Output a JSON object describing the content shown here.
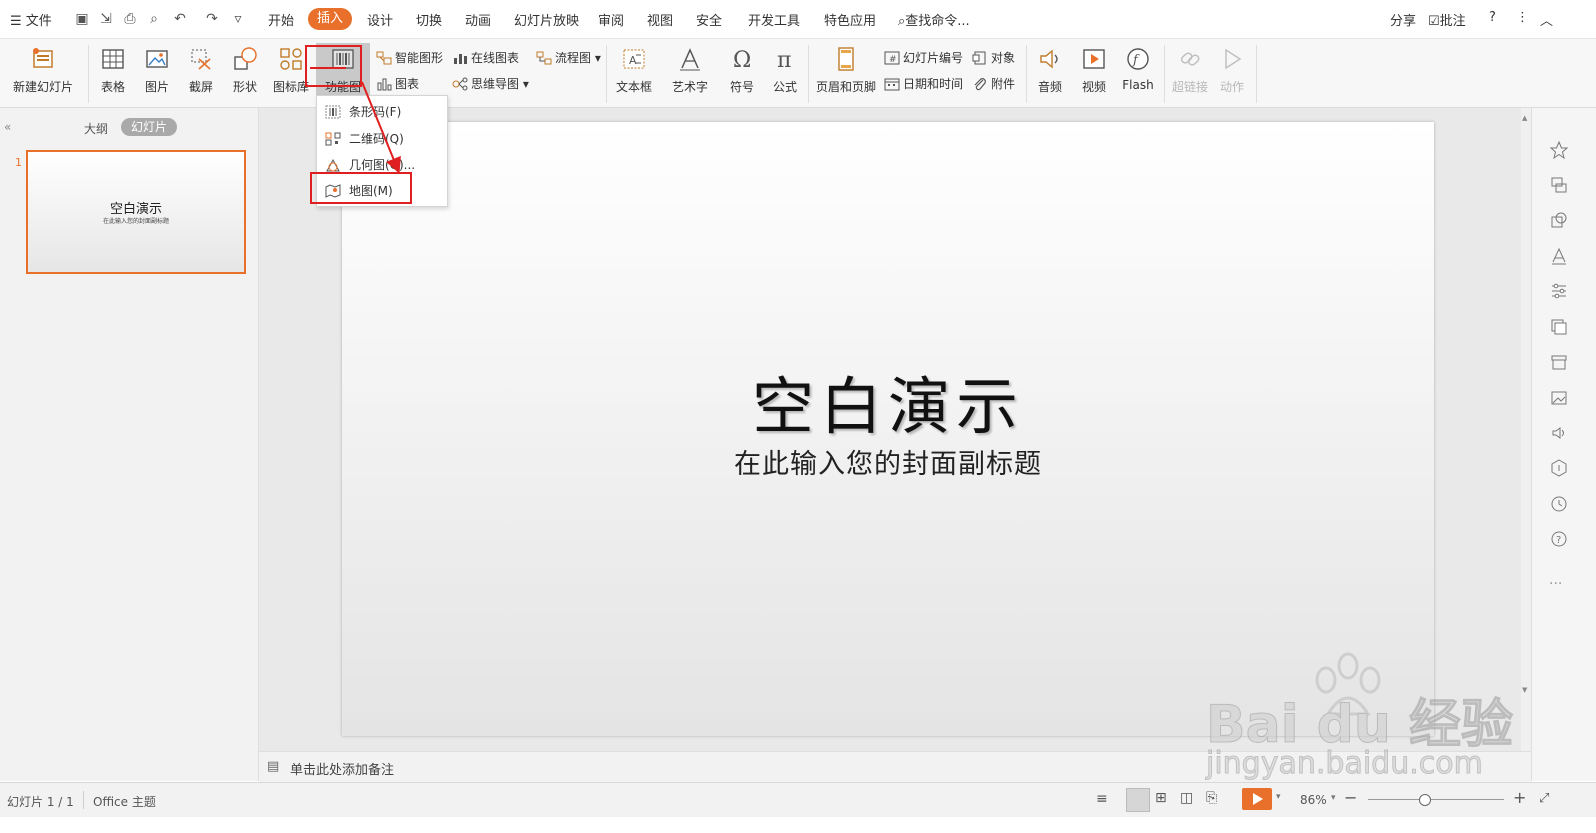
{
  "menubar": {
    "file_label": "文件",
    "tabs": [
      "开始",
      "插入",
      "设计",
      "切换",
      "动画",
      "幻灯片放映",
      "审阅",
      "视图",
      "安全",
      "开发工具",
      "特色应用"
    ],
    "active_tab": "插入",
    "search_label": "查找命令...",
    "share_label": "分享",
    "comment_label": "批注",
    "help_label": "?"
  },
  "ribbon": {
    "new_slide": "新建幻灯片",
    "table": "表格",
    "picture": "图片",
    "screenshot": "截屏",
    "shape": "形状",
    "icon_lib": "图标库",
    "function_chart": "功能图",
    "smart_art": "智能图形",
    "online_chart": "在线图表",
    "flowchart": "流程图",
    "chart": "图表",
    "mindmap": "思维导图",
    "textbox": "文本框",
    "wordart": "艺术字",
    "symbol": "符号",
    "formula": "公式",
    "header_footer": "页眉和页脚",
    "slide_number": "幻灯片编号",
    "object": "对象",
    "date_time": "日期和时间",
    "attachment": "附件",
    "audio": "音频",
    "video": "视频",
    "flash": "Flash",
    "hyperlink": "超链接",
    "action": "动作"
  },
  "dropdown": {
    "items": [
      "条形码(F)",
      "二维码(Q)",
      "几何图(G)...",
      "地图(M)"
    ]
  },
  "left_panel": {
    "view_outline": "大纲",
    "view_slides": "幻灯片",
    "slide_number": "1",
    "thumb_title": "空白演示",
    "thumb_subtitle": "在此输入您的封面副标题"
  },
  "slide": {
    "title": "空白演示",
    "subtitle": "在此输入您的封面副标题"
  },
  "notes": {
    "placeholder": "单击此处添加备注"
  },
  "status": {
    "slide_counter": "幻灯片 1 / 1",
    "theme": "Office 主题",
    "zoom": "86%"
  },
  "watermark": {
    "brand": "Bai du 经验",
    "url": "jingyan.baidu.com"
  },
  "colors": {
    "accent": "#e8702a",
    "highlight": "#e02020"
  }
}
